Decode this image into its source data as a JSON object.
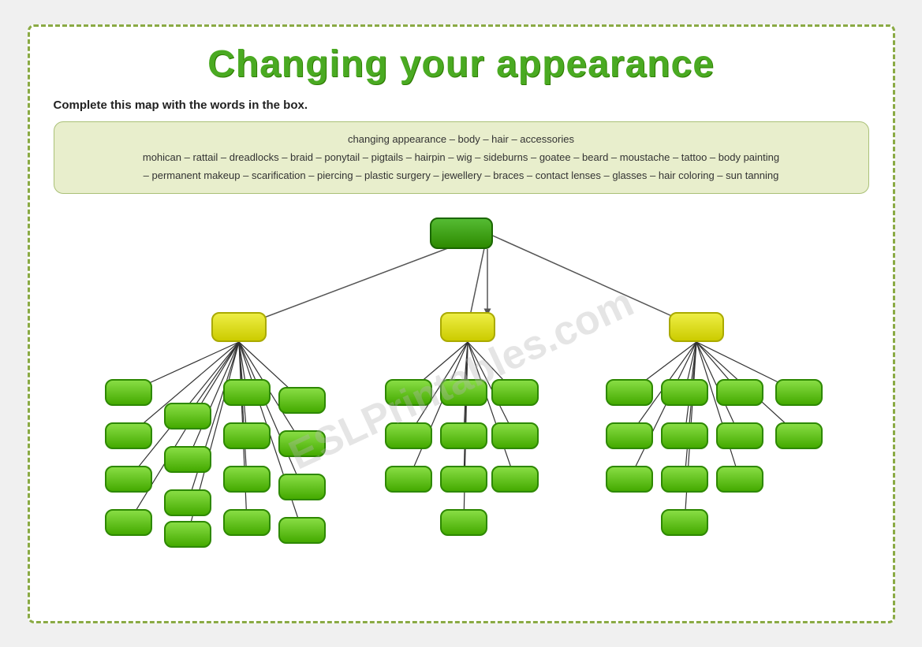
{
  "title": "Changing your appearance",
  "instruction": "Complete this map with the words in the box.",
  "word_box": {
    "line1": "changing appearance – body – hair – accessories",
    "line2": "mohican – rattail – dreadlocks – braid – ponytail – pigtails – hairpin – wig – sideburns – goatee – beard – moustache – tattoo – body painting",
    "line3": "– permanent makeup – scarification – piercing – plastic surgery – jewellery – braces – contact lenses – glasses – hair coloring – sun tanning"
  },
  "watermark": "ESLPrintables.com"
}
